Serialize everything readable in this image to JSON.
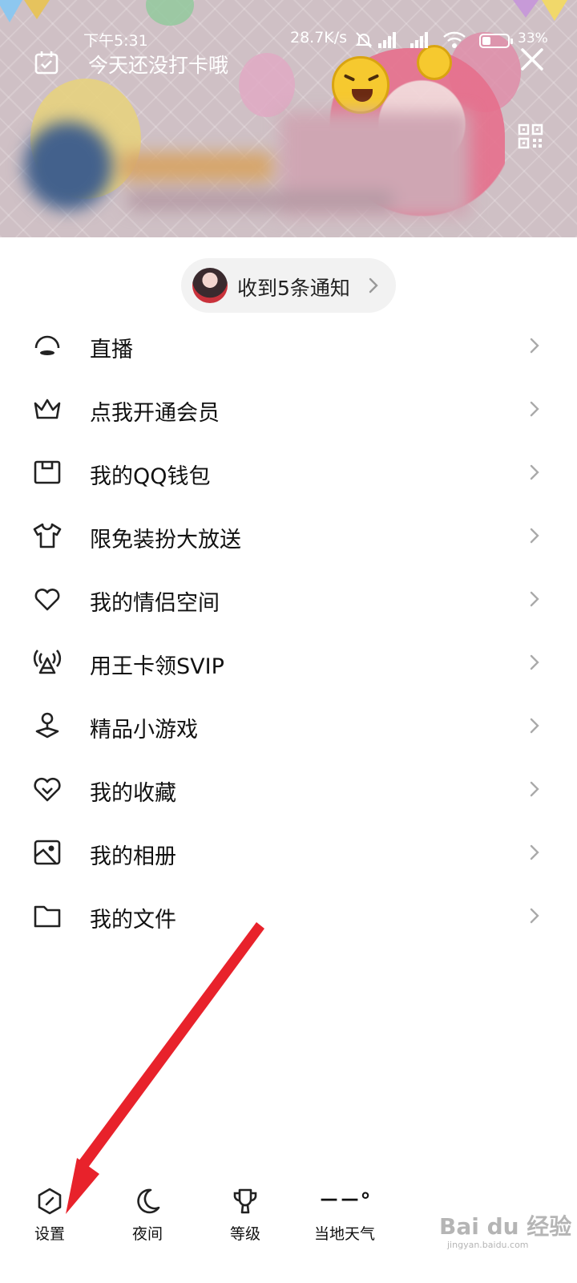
{
  "status_bar": {
    "time": "下午5:31",
    "network_speed": "28.7K/s",
    "battery_percent": "33%",
    "battery_level": 0.33
  },
  "header": {
    "checkin_text": "今天还没打卡哦",
    "icons": [
      "calendar-check-icon",
      "close-icon",
      "qr-code-icon"
    ]
  },
  "notification": {
    "text": "收到5条通知"
  },
  "menu": {
    "items": [
      {
        "label": "直播",
        "icon": "live-icon"
      },
      {
        "label": "点我开通会员",
        "icon": "crown-icon"
      },
      {
        "label": "我的QQ钱包",
        "icon": "wallet-icon"
      },
      {
        "label": "限免装扮大放送",
        "icon": "tshirt-icon"
      },
      {
        "label": "我的情侣空间",
        "icon": "heart-icon"
      },
      {
        "label": "用王卡领SVIP",
        "icon": "signal-tower-icon"
      },
      {
        "label": "精品小游戏",
        "icon": "joystick-icon"
      },
      {
        "label": "我的收藏",
        "icon": "favorite-heart-icon"
      },
      {
        "label": "我的相册",
        "icon": "photo-album-icon"
      },
      {
        "label": "我的文件",
        "icon": "folder-icon"
      }
    ]
  },
  "bottom_bar": {
    "settings": "设置",
    "night": "夜间",
    "level": "等级",
    "weather_value": "－－°",
    "weather": "当地天气"
  },
  "watermark": {
    "brand": "Bai du 经验",
    "url": "jingyan.baidu.com"
  },
  "colors": {
    "annotation_arrow": "#e8222b",
    "text": "#111111",
    "pill_bg": "#f2f2f2"
  }
}
